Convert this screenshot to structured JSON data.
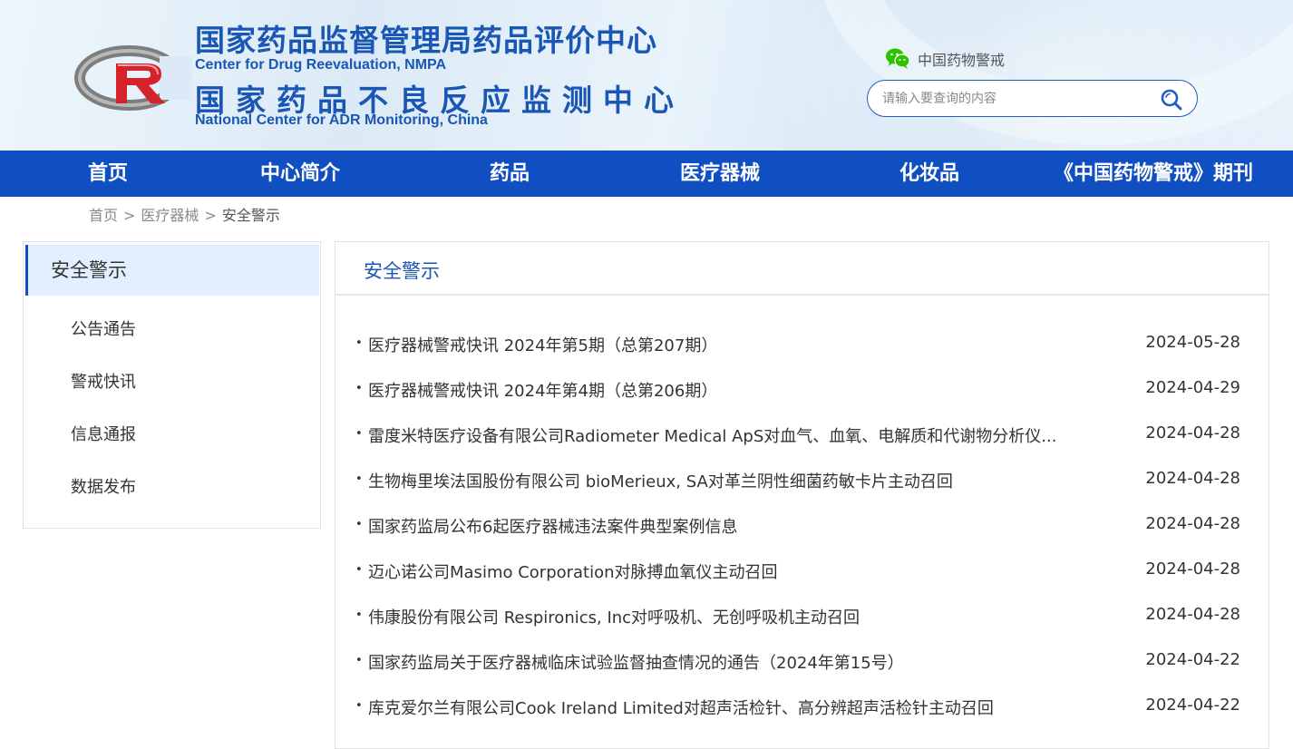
{
  "header": {
    "title_cn_1": "国家药品监督管理局药品评价中心",
    "title_en_1": "Center for Drug Reevaluation, NMPA",
    "title_cn_2": "国家药品不良反应监测中心",
    "title_en_2": "National Center for ADR Monitoring, China",
    "wechat_label": "中国药物警戒",
    "search_placeholder": "请输入要查询的内容"
  },
  "colors": {
    "brand_blue": "#0f4fc1",
    "title_blue": "#1a56b4",
    "wechat_green": "#2dc100",
    "logo_gray": "#7d7d7d",
    "logo_red": "#d6222a"
  },
  "nav": {
    "items": [
      {
        "label": "首页"
      },
      {
        "label": "中心简介"
      },
      {
        "label": "药品"
      },
      {
        "label": "医疗器械"
      },
      {
        "label": "化妆品"
      },
      {
        "label": "《中国药物警戒》期刊"
      }
    ]
  },
  "breadcrumb": {
    "home": "首页",
    "section": "医疗器械",
    "current": "安全警示",
    "separator": ">"
  },
  "sidebar": {
    "active": "安全警示",
    "items": [
      {
        "label": "公告通告"
      },
      {
        "label": "警戒快讯"
      },
      {
        "label": "信息通报"
      },
      {
        "label": "数据发布"
      }
    ]
  },
  "main": {
    "title": "安全警示",
    "bullet": "•",
    "articles": [
      {
        "title": "医疗器械警戒快讯 2024年第5期（总第207期）",
        "date": "2024-05-28"
      },
      {
        "title": "医疗器械警戒快讯 2024年第4期（总第206期）",
        "date": "2024-04-29"
      },
      {
        "title": "雷度米特医疗设备有限公司Radiometer Medical ApS对血气、血氧、电解质和代谢物分析仪...",
        "date": "2024-04-28"
      },
      {
        "title": "生物梅里埃法国股份有限公司 bioMerieux, SA对革兰阴性细菌药敏卡片主动召回",
        "date": "2024-04-28"
      },
      {
        "title": "国家药监局公布6起医疗器械违法案件典型案例信息",
        "date": "2024-04-28"
      },
      {
        "title": "迈心诺公司Masimo Corporation对脉搏血氧仪主动召回",
        "date": "2024-04-28"
      },
      {
        "title": "伟康股份有限公司 Respironics, Inc对呼吸机、无创呼吸机主动召回",
        "date": "2024-04-28"
      },
      {
        "title": "国家药监局关于医疗器械临床试验监督抽查情况的通告（2024年第15号）",
        "date": "2024-04-22"
      },
      {
        "title": "库克爱尔兰有限公司Cook Ireland Limited对超声活检针、高分辨超声活检针主动召回",
        "date": "2024-04-22"
      }
    ]
  }
}
